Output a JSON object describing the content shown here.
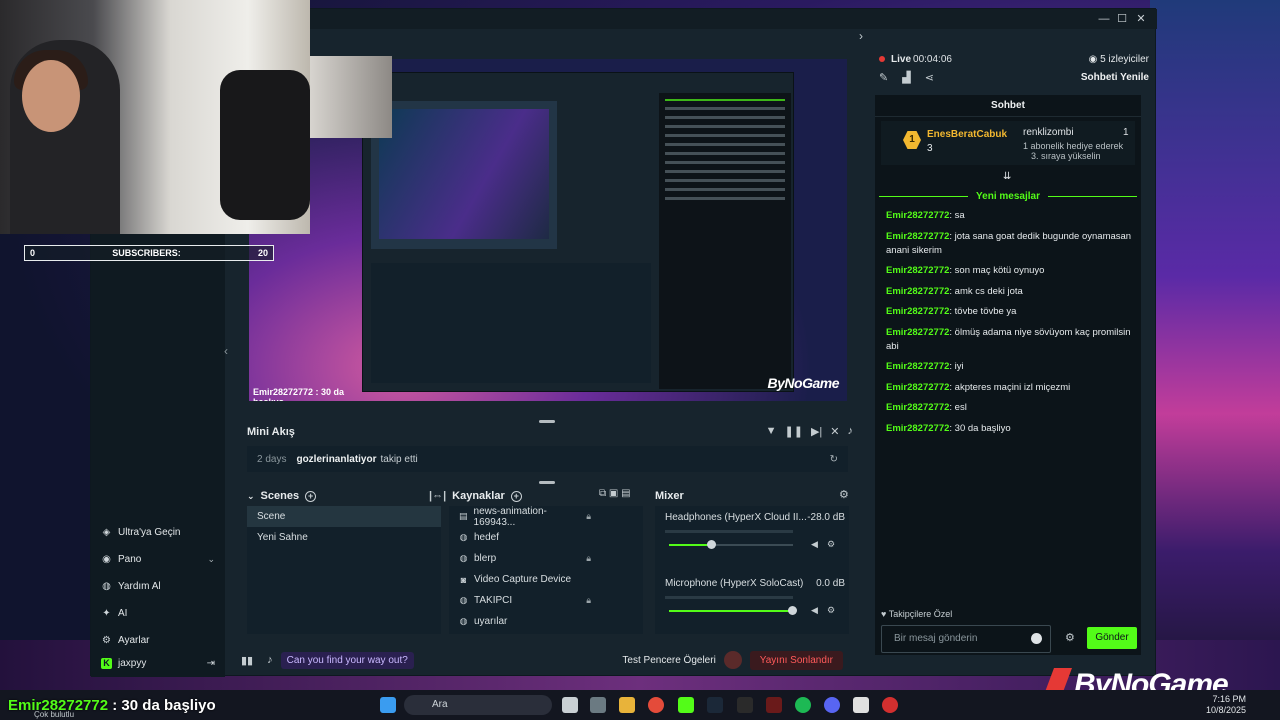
{
  "window": {
    "minimize": "—",
    "maximize": "☐",
    "close": "✕"
  },
  "sidebar": {
    "items": [
      {
        "icon": "kick-icon",
        "label": "Ultra'ya Geçin"
      },
      {
        "icon": "dashboard-icon",
        "label": "Pano",
        "chevron": "⌄"
      },
      {
        "icon": "help-icon",
        "label": "Yardım Al"
      },
      {
        "icon": "sparkle-icon",
        "label": "AI"
      },
      {
        "icon": "gear-icon",
        "label": "Ayarlar"
      }
    ],
    "user": "jaxpyy",
    "logout": "⇥"
  },
  "preview": {
    "ticker": "Emir28272772 : 30 da başlıyo",
    "brand": "ByNoGame"
  },
  "minifeed": {
    "title": "Mini Akış",
    "days": "2 days",
    "user": "gozlerinanlatiyor",
    "action": "takip etti"
  },
  "scenes": {
    "title": "Scenes",
    "items": [
      "Scene",
      "Yeni Sahne"
    ]
  },
  "sources": {
    "title": "Kaynaklar",
    "items": [
      {
        "label": "news-animation-169943...",
        "lock": true
      },
      {
        "label": "hedef",
        "lock": false
      },
      {
        "label": "blerp",
        "lock": true
      },
      {
        "label": "Video Capture Device",
        "lock": false
      },
      {
        "label": "TAKIPCI",
        "lock": true
      },
      {
        "label": "uyarılar",
        "lock": false
      }
    ]
  },
  "mixer": {
    "title": "Mixer",
    "channels": [
      {
        "name": "Headphones (HyperX Cloud II...",
        "db": "-28.0 dB",
        "level": 0.35
      },
      {
        "name": "Microphone (HyperX SoloCast)",
        "db": "0.0 dB",
        "level": 1.0
      }
    ]
  },
  "bottombar": {
    "prompt": "Can you find your way out?",
    "test": "Test Pencere Ögeleri",
    "stop": "Yayını Sonlandır"
  },
  "live": {
    "status": "Live",
    "time": "00:04:06",
    "viewers": "5 izleyiciler",
    "refresh": "Sohbeti Yenile"
  },
  "chat": {
    "title": "Sohbet",
    "pinned": {
      "rank": "1",
      "user": "EnesBeratCabuk",
      "count": "3",
      "right_user": "renklizombi",
      "right_count": "1",
      "line1": "1 abonelik hediye ederek",
      "line2": "3. sıraya yükselin"
    },
    "new_messages": "Yeni mesajlar",
    "messages": [
      {
        "user": "Emir28272772",
        "text": ": sa"
      },
      {
        "user": "Emir28272772",
        "text": ": jota sana goat dedik bugunde oynamasan anani sikerim"
      },
      {
        "user": "Emir28272772",
        "text": ": son maç kötü oynuyo"
      },
      {
        "user": "Emir28272772",
        "text": ": amk cs deki jota"
      },
      {
        "user": "Emir28272772",
        "text": ": tövbe tövbe ya"
      },
      {
        "user": "Emir28272772",
        "text": ": ölmüş adama niye sövüyom kaç promilsin abi"
      },
      {
        "user": "Emir28272772",
        "text": ": iyi"
      },
      {
        "user": "Emir28272772",
        "text": ": akpteres maçini izl miçezmi"
      },
      {
        "user": "Emir28272772",
        "text": ": esl"
      },
      {
        "user": "Emir28272772",
        "text": ": 30 da başliyo"
      }
    ],
    "follow_label": "Takipçilere Özel",
    "input_placeholder": "Bir mesaj gönderin",
    "send": "Gönder"
  },
  "overlay": {
    "subscribers_label": "SUBSCRIBERS:",
    "subscribers_current": "0",
    "subscribers_goal": "20",
    "ticker_user": "Emir28272772",
    "ticker_text": " : 30 da başliyo",
    "brand": "ByNoGame",
    "weather_cond": "Çok bulutlu"
  },
  "taskbar": {
    "search": "Ara",
    "time": "7:16 PM",
    "date": "10/8/2025"
  },
  "colors": {
    "accent": "#53fc18",
    "panel": "#12202a",
    "window": "#17242d",
    "live": "#e53935"
  }
}
